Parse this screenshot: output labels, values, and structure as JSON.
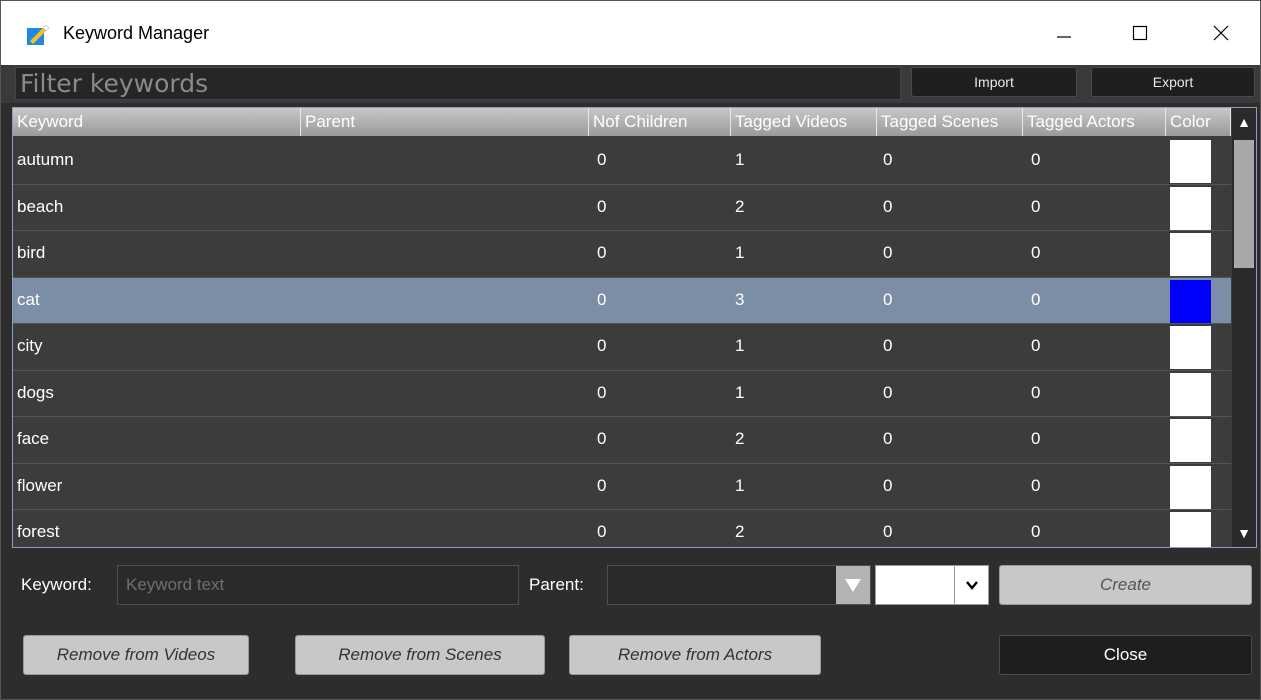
{
  "window": {
    "title": "Keyword Manager",
    "controls": {
      "minimize": "—",
      "maximize": "☐",
      "close": "✕"
    }
  },
  "filter": {
    "placeholder": "Filter keywords",
    "value": ""
  },
  "toolbar": {
    "import_label": "Import",
    "export_label": "Export"
  },
  "table": {
    "columns": [
      "Keyword",
      "Parent",
      "Nof Children",
      "Tagged Videos",
      "Tagged Scenes",
      "Tagged Actors",
      "Color"
    ],
    "rows": [
      {
        "keyword": "autumn",
        "parent": "",
        "children": "0",
        "videos": "1",
        "scenes": "0",
        "actors": "0",
        "color": "#ffffff"
      },
      {
        "keyword": "beach",
        "parent": "",
        "children": "0",
        "videos": "2",
        "scenes": "0",
        "actors": "0",
        "color": "#ffffff"
      },
      {
        "keyword": "bird",
        "parent": "",
        "children": "0",
        "videos": "1",
        "scenes": "0",
        "actors": "0",
        "color": "#ffffff"
      },
      {
        "keyword": "cat",
        "parent": "",
        "children": "0",
        "videos": "3",
        "scenes": "0",
        "actors": "0",
        "color": "#0000ff",
        "selected": true
      },
      {
        "keyword": "city",
        "parent": "",
        "children": "0",
        "videos": "1",
        "scenes": "0",
        "actors": "0",
        "color": "#ffffff"
      },
      {
        "keyword": "dogs",
        "parent": "",
        "children": "0",
        "videos": "1",
        "scenes": "0",
        "actors": "0",
        "color": "#ffffff"
      },
      {
        "keyword": "face",
        "parent": "",
        "children": "0",
        "videos": "2",
        "scenes": "0",
        "actors": "0",
        "color": "#ffffff"
      },
      {
        "keyword": "flower",
        "parent": "",
        "children": "0",
        "videos": "1",
        "scenes": "0",
        "actors": "0",
        "color": "#ffffff"
      },
      {
        "keyword": "forest",
        "parent": "",
        "children": "0",
        "videos": "2",
        "scenes": "0",
        "actors": "0",
        "color": "#ffffff"
      }
    ]
  },
  "form": {
    "keyword_label": "Keyword:",
    "keyword_placeholder": "Keyword text",
    "parent_label": "Parent:",
    "parent_value": "",
    "color_value": "#ffffff",
    "create_label": "Create"
  },
  "actions": {
    "remove_videos": "Remove from Videos",
    "remove_scenes": "Remove from Scenes",
    "remove_actors": "Remove from Actors",
    "close": "Close"
  },
  "colors": {
    "selected_row": "#7c8ea6",
    "background": "#2d2d2d",
    "row": "#3c3c3c"
  }
}
